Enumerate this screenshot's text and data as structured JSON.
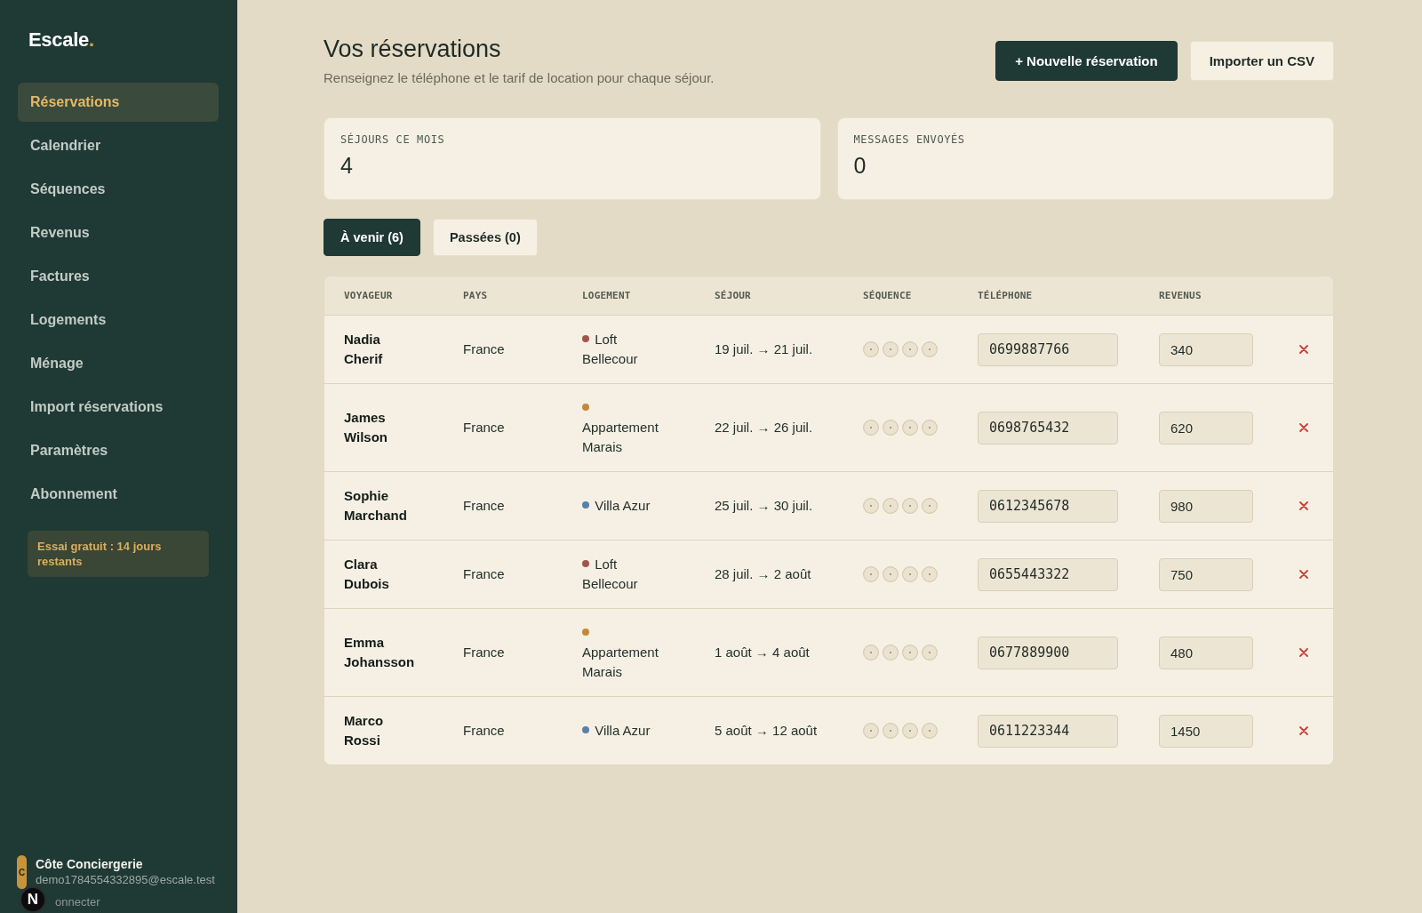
{
  "sidebar": {
    "logo": {
      "text": "Escale",
      "dot": "."
    },
    "nav": [
      {
        "label": "Réservations",
        "selected": true
      },
      {
        "label": "Calendrier",
        "selected": false
      },
      {
        "label": "Séquences",
        "selected": false
      },
      {
        "label": "Revenus",
        "selected": false
      },
      {
        "label": "Factures",
        "selected": false
      },
      {
        "label": "Logements",
        "selected": false
      },
      {
        "label": "Ménage",
        "selected": false
      },
      {
        "label": "Import réservations",
        "selected": false
      },
      {
        "label": "Paramètres",
        "selected": false
      },
      {
        "label": "Abonnement",
        "selected": false
      }
    ],
    "trial_banner": "Essai gratuit : 14 jours restants",
    "account": {
      "initial": "C",
      "name": "Côte Conciergerie",
      "email": "demo1784554332895@escale.test"
    },
    "logout_link": "onnecter"
  },
  "overlay_badge": {
    "letter": "N"
  },
  "header": {
    "title": "Vos réservations",
    "subtitle": "Renseignez le téléphone et le tarif de location pour chaque séjour.",
    "buttons": [
      {
        "label": "+ Nouvelle réservation",
        "kind": "primary"
      },
      {
        "label": "Importer un CSV",
        "kind": "secondary"
      }
    ]
  },
  "stats": [
    {
      "label": "SÉJOURS CE MOIS",
      "value": "4"
    },
    {
      "label": "MESSAGES ENVOYÉS",
      "value": "0"
    }
  ],
  "tabs": [
    {
      "label": "À venir (6)",
      "selected": true
    },
    {
      "label": "Passées (0)",
      "selected": false
    }
  ],
  "table": {
    "columns": [
      "VOYAGEUR",
      "PAYS",
      "LOGEMENT",
      "SÉJOUR",
      "SÉQUENCE",
      "TÉLÉPHONE",
      "REVENUS"
    ],
    "rows": [
      {
        "guest": "Nadia Cherif",
        "country": "France",
        "property": {
          "name": "Loft Bellecour",
          "color": "#a0574a"
        },
        "stay": "19 juil. → 21 juil.",
        "sequence": [
          {
            "sent": false
          },
          {
            "sent": false
          },
          {
            "sent": false
          },
          {
            "sent": false
          }
        ],
        "phone": "0699887766",
        "revenue": "340"
      },
      {
        "guest": "James Wilson",
        "country": "France",
        "property": {
          "name": "Appartement Marais",
          "color": "#c08a3e"
        },
        "stay": "22 juil. → 26 juil.",
        "sequence": [
          {
            "sent": false
          },
          {
            "sent": false
          },
          {
            "sent": false
          },
          {
            "sent": false
          }
        ],
        "phone": "0698765432",
        "revenue": "620"
      },
      {
        "guest": "Sophie Marchand",
        "country": "France",
        "property": {
          "name": "Villa Azur",
          "color": "#5b7fa6"
        },
        "stay": "25 juil. → 30 juil.",
        "sequence": [
          {
            "sent": false
          },
          {
            "sent": false
          },
          {
            "sent": false
          },
          {
            "sent": false
          }
        ],
        "phone": "0612345678",
        "revenue": "980"
      },
      {
        "guest": "Clara Dubois",
        "country": "France",
        "property": {
          "name": "Loft Bellecour",
          "color": "#a0574a"
        },
        "stay": "28 juil. → 2 août",
        "sequence": [
          {
            "sent": false
          },
          {
            "sent": false
          },
          {
            "sent": false
          },
          {
            "sent": false
          }
        ],
        "phone": "0655443322",
        "revenue": "750"
      },
      {
        "guest": "Emma Johansson",
        "country": "France",
        "property": {
          "name": "Appartement Marais",
          "color": "#c08a3e"
        },
        "stay": "1 août → 4 août",
        "sequence": [
          {
            "sent": false
          },
          {
            "sent": false
          },
          {
            "sent": false
          },
          {
            "sent": false
          }
        ],
        "phone": "0677889900",
        "revenue": "480"
      },
      {
        "guest": "Marco Rossi",
        "country": "France",
        "property": {
          "name": "Villa Azur",
          "color": "#5b7fa6"
        },
        "stay": "5 août → 12 août",
        "sequence": [
          {
            "sent": false
          },
          {
            "sent": false
          },
          {
            "sent": false
          },
          {
            "sent": false
          }
        ],
        "phone": "0611223344",
        "revenue": "1450"
      }
    ]
  }
}
